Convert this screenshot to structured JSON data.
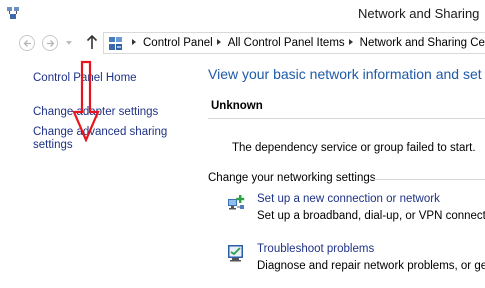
{
  "window": {
    "title": "Network and Sharing",
    "app_icon": "network-sharing-icon"
  },
  "navbar": {
    "back_icon": "back-arrow-icon",
    "forward_icon": "forward-arrow-icon",
    "up_icon": "up-arrow-icon",
    "address_icon": "control-panel-icon",
    "breadcrumbs": [
      "Control Panel",
      "All Control Panel Items",
      "Network and Sharing Cente"
    ]
  },
  "left_pane": {
    "home": "Control Panel Home",
    "change_adapter": "Change adapter settings",
    "change_advanced": "Change advanced sharing settings"
  },
  "main": {
    "heading": "View your basic network information and set",
    "network_name": "Unknown",
    "network_error": "The dependency service or group failed to start.",
    "change_heading": "Change your networking settings",
    "tasks": [
      {
        "icon": "new-connection-icon",
        "link": "Set up a new connection or network",
        "desc": "Set up a broadband, dial-up, or VPN connection"
      },
      {
        "icon": "troubleshoot-icon",
        "link": "Troubleshoot problems",
        "desc": "Diagnose and repair network problems, or get tr"
      }
    ]
  },
  "annotation": {
    "color": "#e8141c"
  },
  "colors": {
    "link": "#1e3287",
    "heading": "#1e5aa8"
  }
}
